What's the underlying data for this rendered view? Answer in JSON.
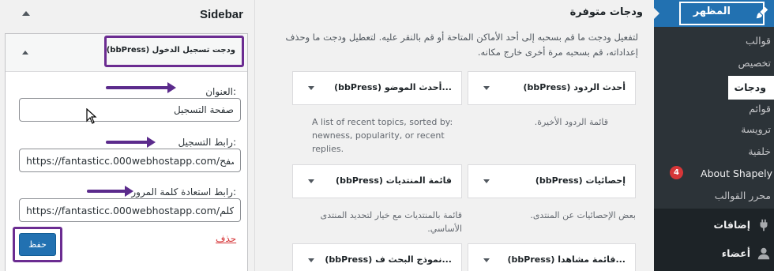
{
  "sidebar": {
    "title": "Sidebar",
    "widget_title": "(bbPress) ودجت تسجيل الدخول",
    "fields": [
      {
        "label": "العنوان:",
        "value": "صفحة التسجيل"
      },
      {
        "label": "رابط التسجيل:",
        "value": "https://fantasticc.000webhostapp.com/صفح"
      },
      {
        "label": "رابط استعادة كلمة المرور:",
        "value": "https://fantasticc.000webhostapp.com/كلم"
      }
    ],
    "save_label": "حفظ",
    "delete_label": "حذف"
  },
  "available": {
    "title": "ودجات متوفرة",
    "description": "لتفعيل ودجت ما قم بسحبه إلى أحد الأماكن المتاحة أو قم بالنقر عليه. لتعطيل ودجت ما وحذف إعداداته، قم بسحبه مرة أخرى خارج مكانه.",
    "widgets": [
      {
        "title": "(bbPress) أحدث الردود",
        "desc": "قائمة الردود الأخيرة."
      },
      {
        "title": "(bbPress) أحدث الموضو...",
        "desc": "A list of recent topics, sorted by: newness, popularity, or recent replies."
      },
      {
        "title": "(bbPress) إحصائيات",
        "desc": "بعض الإحصائيات عن المنتدى."
      },
      {
        "title": "(bbPress) قائمة المنتديات",
        "desc": "قائمة بالمنتديات مع خيار لتحديد المنتدى الأساسي."
      },
      {
        "title": "(bbPress) قائمة مشاهدا...",
        "desc": ""
      },
      {
        "title": "(bbPress) نموذج البحث ف...",
        "desc": ""
      }
    ]
  },
  "admin_menu": {
    "appearance": "المظهر",
    "submenu": [
      "قوالب",
      "تخصيص",
      "ودجات",
      "قوائم",
      "ترويسة",
      "خلفية",
      "About Shapely",
      "محرر القوالب"
    ],
    "badge_count": "4",
    "plugins": "إضافات",
    "users": "أعضاء"
  }
}
